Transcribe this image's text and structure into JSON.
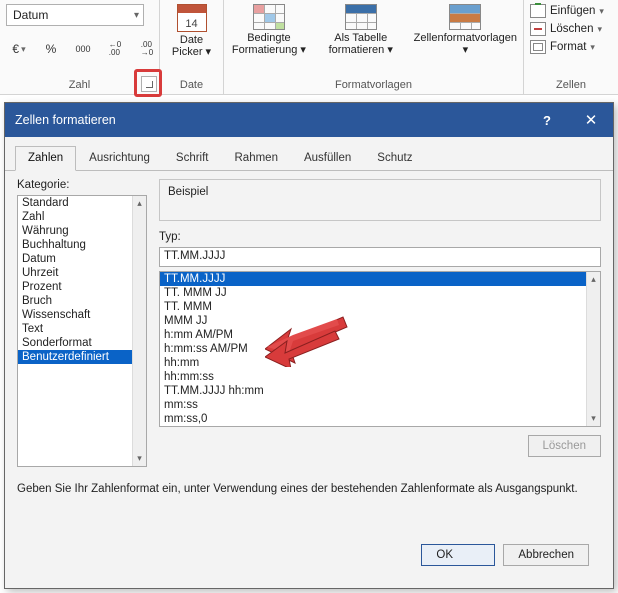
{
  "ribbon": {
    "zahl": {
      "combo_value": "Datum",
      "label": "Zahl",
      "currency_icon": "€",
      "percent_icon": "%",
      "thousands_icon": "000",
      "inc_dec_icon": "←0\n.00",
      "dec_inc_icon": ".00\n→0"
    },
    "date": {
      "cal_num": "14",
      "label": "Date Picker ▾",
      "group_label": "Date"
    },
    "fmt": {
      "cond": "Bedingte Formatierung ▾",
      "table": "Als Tabelle formatieren ▾",
      "styles": "Zellenformatvorlagen ▾",
      "group_label": "Formatvorlagen"
    },
    "zellen": {
      "insert": "Einfügen",
      "delete": "Löschen",
      "format": "Format",
      "group_label": "Zellen"
    }
  },
  "dialog": {
    "title": "Zellen formatieren",
    "tabs": [
      "Zahlen",
      "Ausrichtung",
      "Schrift",
      "Rahmen",
      "Ausfüllen",
      "Schutz"
    ],
    "active_tab": 0,
    "kategorie_label": "Kategorie:",
    "kategorie_items": [
      "Standard",
      "Zahl",
      "Währung",
      "Buchhaltung",
      "Datum",
      "Uhrzeit",
      "Prozent",
      "Bruch",
      "Wissenschaft",
      "Text",
      "Sonderformat",
      "Benutzerdefiniert"
    ],
    "kategorie_selected": 11,
    "beispiel_label": "Beispiel",
    "typ_label": "Typ:",
    "typ_value": "TT.MM.JJJJ",
    "format_items": [
      "TT.MM.JJJJ",
      "TT. MMM JJ",
      "TT. MMM",
      "MMM JJ",
      "h:mm AM/PM",
      "h:mm:ss AM/PM",
      "hh:mm",
      "hh:mm:ss",
      "TT.MM.JJJJ hh:mm",
      "mm:ss",
      "mm:ss,0",
      "@"
    ],
    "format_selected": 0,
    "delete_btn": "Löschen",
    "hint": "Geben Sie Ihr Zahlenformat ein, unter Verwendung eines der bestehenden Zahlenformate als Ausgangspunkt.",
    "ok": "OK",
    "cancel": "Abbrechen",
    "help": "?",
    "close": "✕"
  }
}
